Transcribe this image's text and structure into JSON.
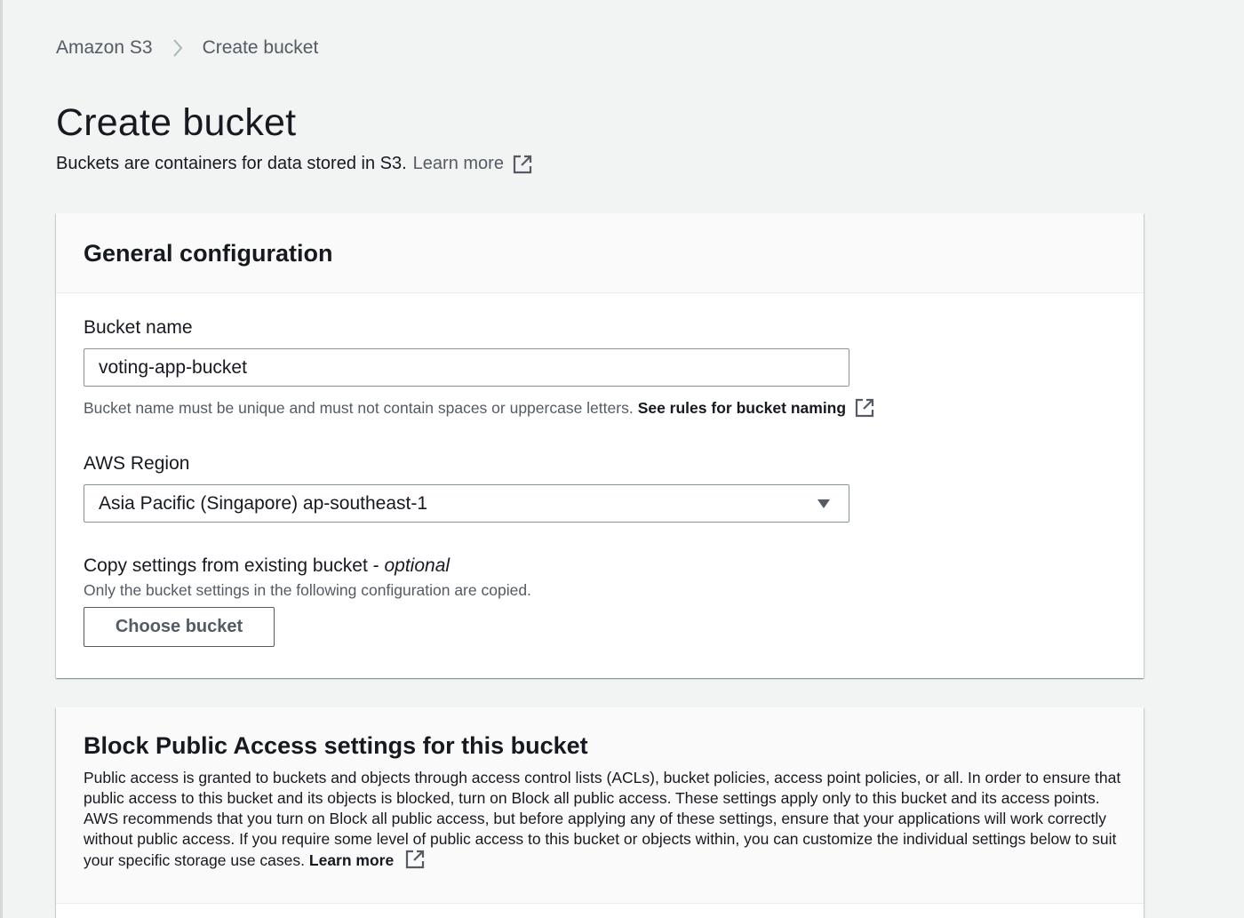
{
  "breadcrumb": {
    "root": "Amazon S3",
    "current": "Create bucket"
  },
  "page": {
    "title": "Create bucket",
    "description": "Buckets are containers for data stored in S3.",
    "learn_more": "Learn more"
  },
  "general_config": {
    "title": "General configuration",
    "bucket_name_label": "Bucket name",
    "bucket_name_value": "voting-app-bucket",
    "bucket_name_hint": "Bucket name must be unique and must not contain spaces or uppercase letters.",
    "bucket_name_rules_link": "See rules for bucket naming",
    "region_label": "AWS Region",
    "region_value": "Asia Pacific (Singapore) ap-southeast-1",
    "copy_label": "Copy settings from existing bucket - ",
    "copy_optional": "optional",
    "copy_hint": "Only the bucket settings in the following configuration are copied.",
    "choose_bucket_label": "Choose bucket"
  },
  "block_public_access": {
    "title": "Block Public Access settings for this bucket",
    "description": "Public access is granted to buckets and objects through access control lists (ACLs), bucket policies, access point policies, or all. In order to ensure that public access to this bucket and its objects is blocked, turn on Block all public access. These settings apply only to this bucket and its access points. AWS recommends that you turn on Block all public access, but before applying any of these settings, ensure that your applications will work correctly without public access. If you require some level of public access to this bucket or objects within, you can customize the individual settings below to suit your specific storage use cases.",
    "learn_more": "Learn more"
  },
  "icons": {
    "breadcrumb_separator": "chevron-right-icon",
    "external_link": "external-link-icon",
    "select_caret": "caret-down-icon"
  },
  "colors": {
    "background": "#f2f3f3",
    "card": "#ffffff",
    "card_header": "#fafafa",
    "text": "#16191f",
    "muted": "#545b64",
    "border": "#879596"
  }
}
